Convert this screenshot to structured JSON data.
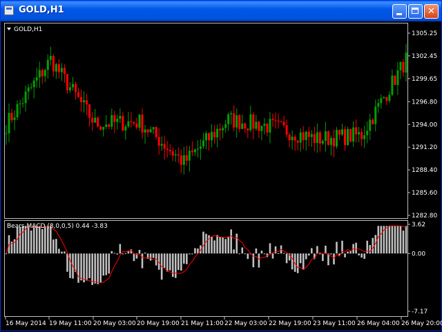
{
  "window": {
    "title": "GOLD,H1"
  },
  "main_panel": {
    "label": "GOLD,H1",
    "price_ticks": [
      "1305.25",
      "1302.45",
      "1299.65",
      "1296.80",
      "1294.00",
      "1291.20",
      "1288.40",
      "1285.60",
      "1282.80"
    ]
  },
  "indicator_panel": {
    "label": "Bears MACD (8,0,0,5) 0.44 -3.83",
    "ticks": [
      "3.62",
      "0.00",
      "-7.17"
    ]
  },
  "time_axis": [
    "16 May 2014",
    "19 May 11:00",
    "20 May 03:00",
    "20 May 19:00",
    "21 May 11:00",
    "22 May 03:00",
    "22 May 19:00",
    "23 May 11:00",
    "26 May 04:00",
    "26 May 20:00"
  ],
  "colors": {
    "up": "#00a000",
    "down": "#ff0000",
    "histogram": "#c0c0c0",
    "signal": "#ff0000",
    "frame": "#c0c0c0"
  },
  "chart_data": [
    {
      "type": "candlestick",
      "symbol": "GOLD",
      "timeframe": "H1",
      "ylim": [
        1282.8,
        1305.25
      ],
      "y_ticks": [
        1305.25,
        1302.45,
        1299.65,
        1296.8,
        1294.0,
        1291.2,
        1288.4,
        1285.6,
        1282.8
      ],
      "x_labels": [
        "16 May 2014",
        "19 May 11:00",
        "20 May 03:00",
        "20 May 19:00",
        "21 May 11:00",
        "22 May 03:00",
        "22 May 19:00",
        "23 May 11:00",
        "26 May 04:00",
        "26 May 20:00"
      ],
      "key_points": [
        {
          "label": "16 May 2014",
          "close": 1294.0
        },
        {
          "label": "19 May 11:00",
          "close": 1302.0
        },
        {
          "label": "20 May 03:00",
          "close": 1294.1
        },
        {
          "label": "20 May 19:00",
          "close": 1294.3
        },
        {
          "label": "21 May 11:00",
          "close": 1289.3
        },
        {
          "label": "22 May 03:00",
          "close": 1294.6
        },
        {
          "label": "22 May 19:00",
          "close": 1293.7
        },
        {
          "label": "23 May 11:00",
          "close": 1292.2
        },
        {
          "label": "26 May 04:00",
          "close": 1292.7
        },
        {
          "label": "26 May 20:00",
          "close": 1302.0
        }
      ]
    },
    {
      "type": "histogram",
      "name": "Bears MACD (8,0,0,5)",
      "current_values": [
        0.44,
        -3.83
      ],
      "ylim": [
        -7.17,
        3.62
      ],
      "y_ticks": [
        3.62,
        0.0,
        -7.17
      ]
    }
  ]
}
